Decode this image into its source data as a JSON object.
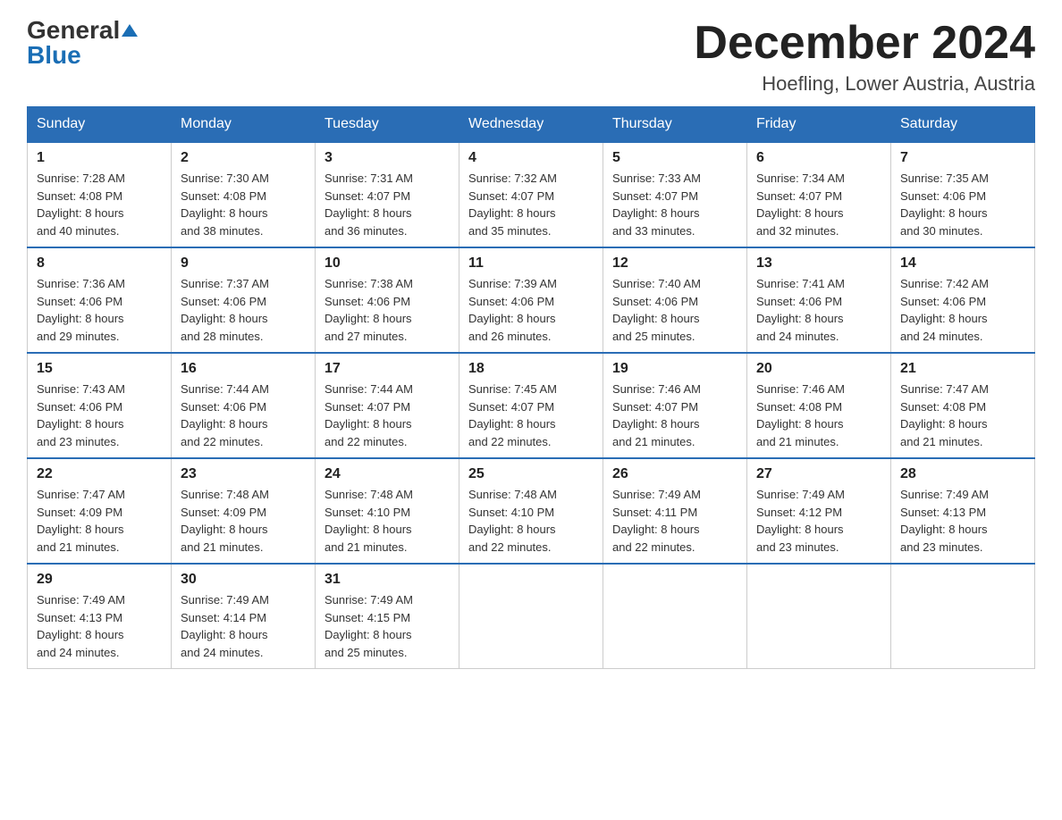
{
  "logo": {
    "general": "General",
    "blue": "Blue"
  },
  "title": "December 2024",
  "location": "Hoefling, Lower Austria, Austria",
  "weekdays": [
    "Sunday",
    "Monday",
    "Tuesday",
    "Wednesday",
    "Thursday",
    "Friday",
    "Saturday"
  ],
  "weeks": [
    [
      {
        "day": "1",
        "sunrise": "Sunrise: 7:28 AM",
        "sunset": "Sunset: 4:08 PM",
        "daylight": "Daylight: 8 hours",
        "minutes": "and 40 minutes."
      },
      {
        "day": "2",
        "sunrise": "Sunrise: 7:30 AM",
        "sunset": "Sunset: 4:08 PM",
        "daylight": "Daylight: 8 hours",
        "minutes": "and 38 minutes."
      },
      {
        "day": "3",
        "sunrise": "Sunrise: 7:31 AM",
        "sunset": "Sunset: 4:07 PM",
        "daylight": "Daylight: 8 hours",
        "minutes": "and 36 minutes."
      },
      {
        "day": "4",
        "sunrise": "Sunrise: 7:32 AM",
        "sunset": "Sunset: 4:07 PM",
        "daylight": "Daylight: 8 hours",
        "minutes": "and 35 minutes."
      },
      {
        "day": "5",
        "sunrise": "Sunrise: 7:33 AM",
        "sunset": "Sunset: 4:07 PM",
        "daylight": "Daylight: 8 hours",
        "minutes": "and 33 minutes."
      },
      {
        "day": "6",
        "sunrise": "Sunrise: 7:34 AM",
        "sunset": "Sunset: 4:07 PM",
        "daylight": "Daylight: 8 hours",
        "minutes": "and 32 minutes."
      },
      {
        "day": "7",
        "sunrise": "Sunrise: 7:35 AM",
        "sunset": "Sunset: 4:06 PM",
        "daylight": "Daylight: 8 hours",
        "minutes": "and 30 minutes."
      }
    ],
    [
      {
        "day": "8",
        "sunrise": "Sunrise: 7:36 AM",
        "sunset": "Sunset: 4:06 PM",
        "daylight": "Daylight: 8 hours",
        "minutes": "and 29 minutes."
      },
      {
        "day": "9",
        "sunrise": "Sunrise: 7:37 AM",
        "sunset": "Sunset: 4:06 PM",
        "daylight": "Daylight: 8 hours",
        "minutes": "and 28 minutes."
      },
      {
        "day": "10",
        "sunrise": "Sunrise: 7:38 AM",
        "sunset": "Sunset: 4:06 PM",
        "daylight": "Daylight: 8 hours",
        "minutes": "and 27 minutes."
      },
      {
        "day": "11",
        "sunrise": "Sunrise: 7:39 AM",
        "sunset": "Sunset: 4:06 PM",
        "daylight": "Daylight: 8 hours",
        "minutes": "and 26 minutes."
      },
      {
        "day": "12",
        "sunrise": "Sunrise: 7:40 AM",
        "sunset": "Sunset: 4:06 PM",
        "daylight": "Daylight: 8 hours",
        "minutes": "and 25 minutes."
      },
      {
        "day": "13",
        "sunrise": "Sunrise: 7:41 AM",
        "sunset": "Sunset: 4:06 PM",
        "daylight": "Daylight: 8 hours",
        "minutes": "and 24 minutes."
      },
      {
        "day": "14",
        "sunrise": "Sunrise: 7:42 AM",
        "sunset": "Sunset: 4:06 PM",
        "daylight": "Daylight: 8 hours",
        "minutes": "and 24 minutes."
      }
    ],
    [
      {
        "day": "15",
        "sunrise": "Sunrise: 7:43 AM",
        "sunset": "Sunset: 4:06 PM",
        "daylight": "Daylight: 8 hours",
        "minutes": "and 23 minutes."
      },
      {
        "day": "16",
        "sunrise": "Sunrise: 7:44 AM",
        "sunset": "Sunset: 4:06 PM",
        "daylight": "Daylight: 8 hours",
        "minutes": "and 22 minutes."
      },
      {
        "day": "17",
        "sunrise": "Sunrise: 7:44 AM",
        "sunset": "Sunset: 4:07 PM",
        "daylight": "Daylight: 8 hours",
        "minutes": "and 22 minutes."
      },
      {
        "day": "18",
        "sunrise": "Sunrise: 7:45 AM",
        "sunset": "Sunset: 4:07 PM",
        "daylight": "Daylight: 8 hours",
        "minutes": "and 22 minutes."
      },
      {
        "day": "19",
        "sunrise": "Sunrise: 7:46 AM",
        "sunset": "Sunset: 4:07 PM",
        "daylight": "Daylight: 8 hours",
        "minutes": "and 21 minutes."
      },
      {
        "day": "20",
        "sunrise": "Sunrise: 7:46 AM",
        "sunset": "Sunset: 4:08 PM",
        "daylight": "Daylight: 8 hours",
        "minutes": "and 21 minutes."
      },
      {
        "day": "21",
        "sunrise": "Sunrise: 7:47 AM",
        "sunset": "Sunset: 4:08 PM",
        "daylight": "Daylight: 8 hours",
        "minutes": "and 21 minutes."
      }
    ],
    [
      {
        "day": "22",
        "sunrise": "Sunrise: 7:47 AM",
        "sunset": "Sunset: 4:09 PM",
        "daylight": "Daylight: 8 hours",
        "minutes": "and 21 minutes."
      },
      {
        "day": "23",
        "sunrise": "Sunrise: 7:48 AM",
        "sunset": "Sunset: 4:09 PM",
        "daylight": "Daylight: 8 hours",
        "minutes": "and 21 minutes."
      },
      {
        "day": "24",
        "sunrise": "Sunrise: 7:48 AM",
        "sunset": "Sunset: 4:10 PM",
        "daylight": "Daylight: 8 hours",
        "minutes": "and 21 minutes."
      },
      {
        "day": "25",
        "sunrise": "Sunrise: 7:48 AM",
        "sunset": "Sunset: 4:10 PM",
        "daylight": "Daylight: 8 hours",
        "minutes": "and 22 minutes."
      },
      {
        "day": "26",
        "sunrise": "Sunrise: 7:49 AM",
        "sunset": "Sunset: 4:11 PM",
        "daylight": "Daylight: 8 hours",
        "minutes": "and 22 minutes."
      },
      {
        "day": "27",
        "sunrise": "Sunrise: 7:49 AM",
        "sunset": "Sunset: 4:12 PM",
        "daylight": "Daylight: 8 hours",
        "minutes": "and 23 minutes."
      },
      {
        "day": "28",
        "sunrise": "Sunrise: 7:49 AM",
        "sunset": "Sunset: 4:13 PM",
        "daylight": "Daylight: 8 hours",
        "minutes": "and 23 minutes."
      }
    ],
    [
      {
        "day": "29",
        "sunrise": "Sunrise: 7:49 AM",
        "sunset": "Sunset: 4:13 PM",
        "daylight": "Daylight: 8 hours",
        "minutes": "and 24 minutes."
      },
      {
        "day": "30",
        "sunrise": "Sunrise: 7:49 AM",
        "sunset": "Sunset: 4:14 PM",
        "daylight": "Daylight: 8 hours",
        "minutes": "and 24 minutes."
      },
      {
        "day": "31",
        "sunrise": "Sunrise: 7:49 AM",
        "sunset": "Sunset: 4:15 PM",
        "daylight": "Daylight: 8 hours",
        "minutes": "and 25 minutes."
      },
      null,
      null,
      null,
      null
    ]
  ]
}
